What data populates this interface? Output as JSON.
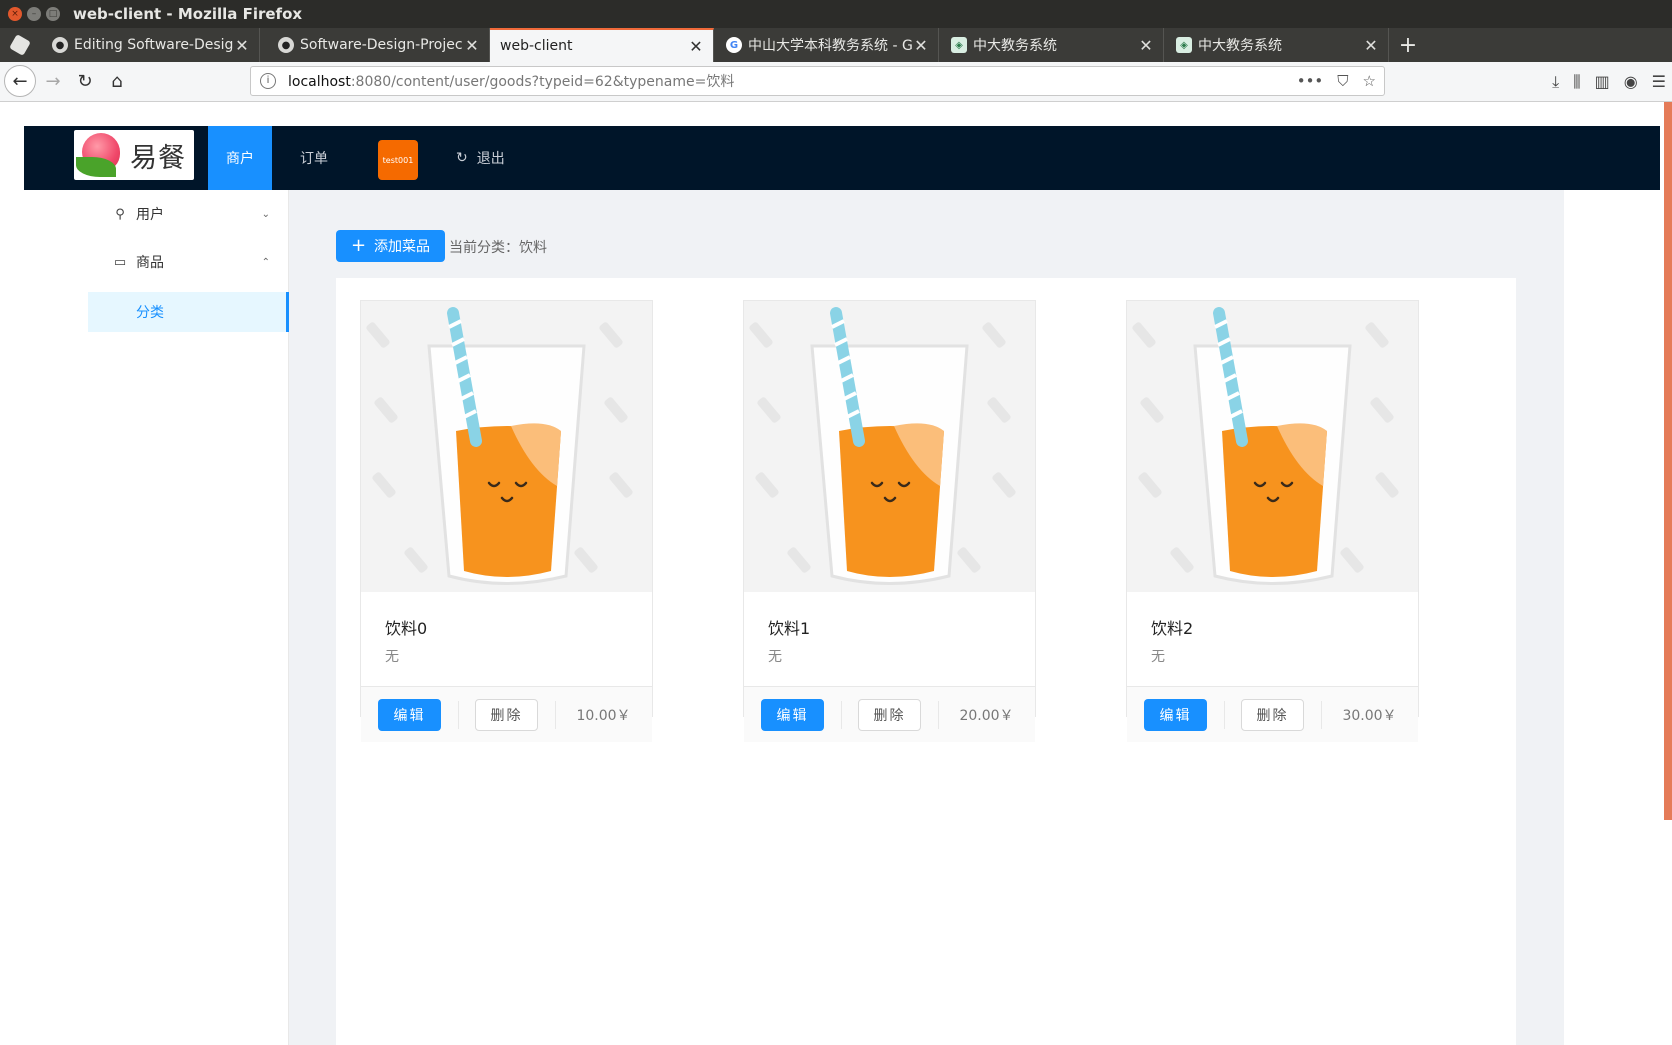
{
  "window": {
    "title": "web-client - Mozilla Firefox"
  },
  "tabs": [
    {
      "label": "Editing Software-Design",
      "favicon": "github-icon"
    },
    {
      "label": "Software-Design-Projec",
      "favicon": "github-icon"
    },
    {
      "label": "web-client",
      "favicon": "",
      "active": true
    },
    {
      "label": "中山大学本科教务系统 - G",
      "favicon": "google-icon"
    },
    {
      "label": "中大教务系统",
      "favicon": "sysu-icon"
    },
    {
      "label": "中大教务系统",
      "favicon": "sysu-icon"
    }
  ],
  "address": {
    "host": "localhost",
    "rest": ":8080/content/user/goods?typeid=62&typename=饮料"
  },
  "app": {
    "logo_text": "易餐",
    "menu": {
      "merchant": "商户",
      "orders": "订单",
      "user_badge": "test001",
      "logout": "退出"
    },
    "sidebar": {
      "user": "用户",
      "goods": "商品",
      "category": "分类"
    },
    "toolbar": {
      "add_label": "添加菜品",
      "current_prefix": "当前分类：",
      "current_category": "饮料"
    },
    "cards": [
      {
        "name": "饮料0",
        "desc": "无",
        "edit": "编辑",
        "delete": "删除",
        "price": "10.00￥"
      },
      {
        "name": "饮料1",
        "desc": "无",
        "edit": "编辑",
        "delete": "删除",
        "price": "20.00￥"
      },
      {
        "name": "饮料2",
        "desc": "无",
        "edit": "编辑",
        "delete": "删除",
        "price": "30.00￥"
      }
    ]
  },
  "colors": {
    "header_bg": "#001529",
    "primary": "#1890ff",
    "badge": "#f56a00",
    "juice": "#f7931e"
  }
}
